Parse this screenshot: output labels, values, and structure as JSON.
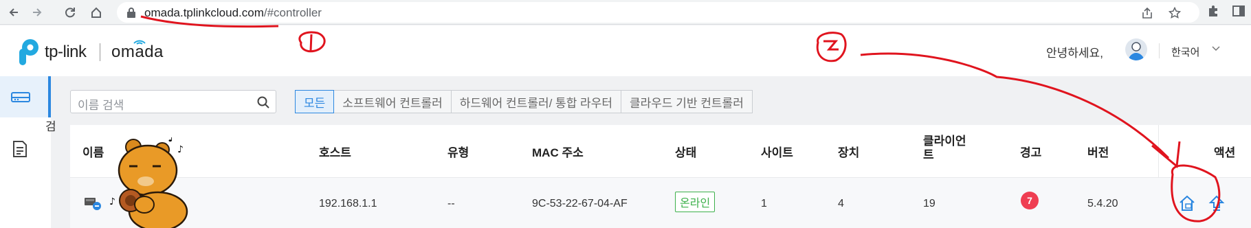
{
  "browser": {
    "url_host": "omada.tplinkcloud.com",
    "url_path": "/#controller"
  },
  "header": {
    "brand_tp": "tp-link",
    "brand_omada": "omada",
    "greeting": "안녕하세요,",
    "language": "한국어"
  },
  "sidebar": {
    "items": [
      {
        "icon": "controller-list-icon",
        "active": true
      },
      {
        "icon": "document-icon",
        "active": false
      }
    ],
    "cut_text": "검"
  },
  "toolbar": {
    "search_placeholder": "이름 검색",
    "filters": [
      {
        "label": "모든",
        "active": true
      },
      {
        "label": "소프트웨어 컨트롤러",
        "active": false
      },
      {
        "label": "하드웨어 컨트롤러/ 통합 라우터",
        "active": false
      },
      {
        "label": "클라우드 기반 컨트롤러",
        "active": false
      }
    ]
  },
  "table": {
    "headers": {
      "name": "이름",
      "host": "호스트",
      "type": "유형",
      "mac": "MAC 주소",
      "status": "상태",
      "sites": "사이트",
      "devices": "장치",
      "clients_l1": "클라이언",
      "clients_l2": "트",
      "alerts": "경고",
      "version": "버전",
      "actions": "액션"
    },
    "rows": [
      {
        "host": "192.168.1.1",
        "type": "--",
        "mac": "9C-53-22-67-04-AF",
        "status": "온라인",
        "sites": "1",
        "devices": "4",
        "clients": "19",
        "alerts": "7",
        "version": "5.4.20"
      }
    ]
  },
  "annotations": {
    "marker1": "1",
    "marker2": "2",
    "color": "#e0141e"
  },
  "colors": {
    "accent": "#2b87e0",
    "online": "#3cb04a",
    "alert": "#ef3e52",
    "brand": "#22a9e0"
  }
}
